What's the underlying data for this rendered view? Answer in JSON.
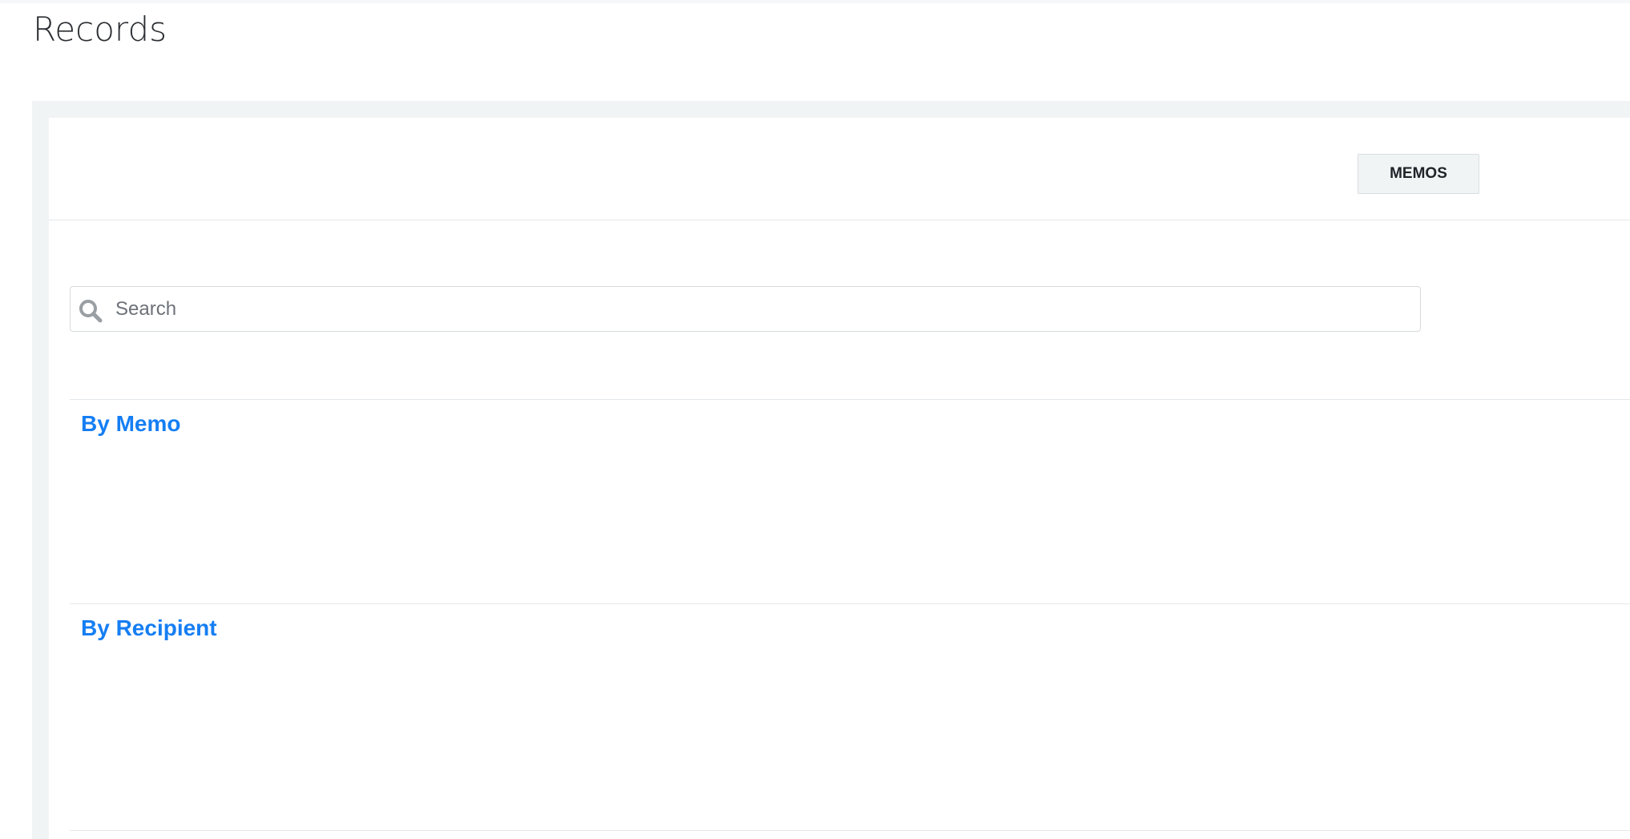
{
  "page": {
    "title": "Records"
  },
  "header": {
    "memos_button_label": "MEMOS"
  },
  "search": {
    "placeholder": "Search",
    "value": ""
  },
  "sections": [
    {
      "label": "By Memo"
    },
    {
      "label": "By Recipient"
    }
  ],
  "colors": {
    "link": "#157ef3",
    "panel_frame": "#f1f4f5",
    "button_bg": "#f1f4f5",
    "divider": "#e4e7ea",
    "search_icon": "#9a9fa4"
  },
  "icons": {
    "search": "search-icon"
  }
}
